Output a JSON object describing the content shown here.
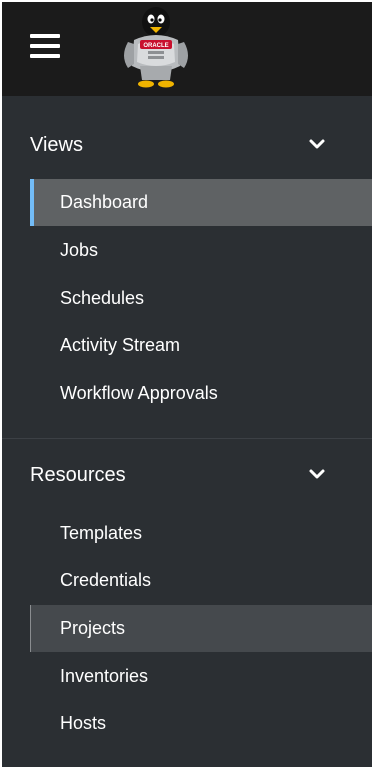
{
  "topbar": {
    "menu_icon": "hamburger-icon",
    "logo_icon": "oracle-penguin-logo",
    "logo_text": "ORACLE"
  },
  "views": {
    "title": "Views",
    "chevron_icon": "chevron-down-icon",
    "items": [
      {
        "label": "Dashboard"
      },
      {
        "label": "Jobs"
      },
      {
        "label": "Schedules"
      },
      {
        "label": "Activity Stream"
      },
      {
        "label": "Workflow Approvals"
      }
    ]
  },
  "resources": {
    "title": "Resources",
    "chevron_icon": "chevron-down-icon",
    "items": [
      {
        "label": "Templates"
      },
      {
        "label": "Credentials"
      },
      {
        "label": "Projects"
      },
      {
        "label": "Inventories"
      },
      {
        "label": "Hosts"
      }
    ]
  },
  "colors": {
    "active_accent": "#73bcf7",
    "active_bg": "#5f6264",
    "hover_bg": "#45494d",
    "sidebar_bg": "#2b2f33",
    "topbar_bg": "#1b1b1b"
  }
}
